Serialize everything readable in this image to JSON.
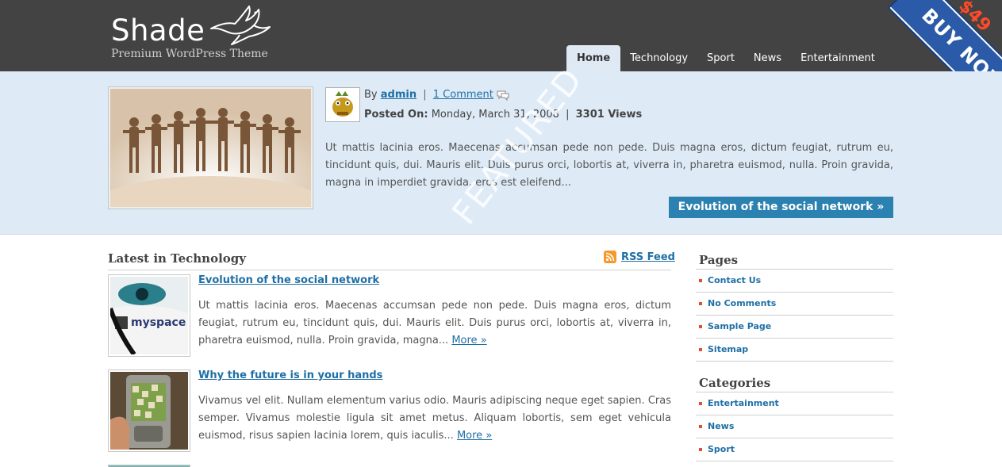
{
  "header": {
    "logo_title": "Shade",
    "tagline": "Premium WordPress Theme",
    "nav": [
      "Home",
      "Technology",
      "Sport",
      "News",
      "Entertainment"
    ],
    "active_nav": "Home",
    "ribbon_price": "$49",
    "ribbon_text": "BUY NOW!"
  },
  "featured": {
    "by_label": "By",
    "author": "admin",
    "comments": "1 Comment",
    "posted_label": "Posted On:",
    "date": "Monday, March 31, 2008",
    "views": "3301 Views",
    "excerpt": "Ut mattis lacinia eros. Maecenas accumsan pede non pede. Duis magna eros, dictum feugiat, rutrum eu, tincidunt quis, dui. Mauris elit. Duis purus orci, lobortis at, viverra in, pharetra euismod, nulla. Proin gravida, magna in imperdiet gravida, eros est eleifend...",
    "button": "Evolution of the social network »",
    "watermark": "FEATURED"
  },
  "latest": {
    "title": "Latest in Technology",
    "rss": "RSS Feed",
    "more": "More »",
    "posts": [
      {
        "title": "Evolution of the social network",
        "body": "Ut mattis lacinia eros. Maecenas accumsan pede non pede. Duis magna eros, dictum feugiat, rutrum eu, tincidunt quis, dui. Mauris elit. Duis purus orci, lobortis at, viverra in, pharetra euismod, nulla. Proin gravida, magna..."
      },
      {
        "title": "Why the future is in your hands",
        "body": "Vivamus vel elit. Nullam elementum varius odio. Mauris adipiscing neque eget sapien. Cras semper. Vivamus molestie ligula sit amet metus. Aliquam lobortis, sem eget vehicula euismod, risus sapien lacinia lorem, quis iaculis..."
      }
    ]
  },
  "sidebar": {
    "pages_title": "Pages",
    "pages": [
      "Contact Us",
      "No Comments",
      "Sample Page",
      "Sitemap"
    ],
    "categories_title": "Categories",
    "categories": [
      "Entertainment",
      "News",
      "Sport"
    ]
  },
  "colors": {
    "header_bg": "#434343",
    "featured_bg": "#deebf7",
    "link": "#1f6fa6",
    "button": "#2b81b0",
    "ribbon": "#2a5aa8",
    "bullet": "#e0512a"
  }
}
